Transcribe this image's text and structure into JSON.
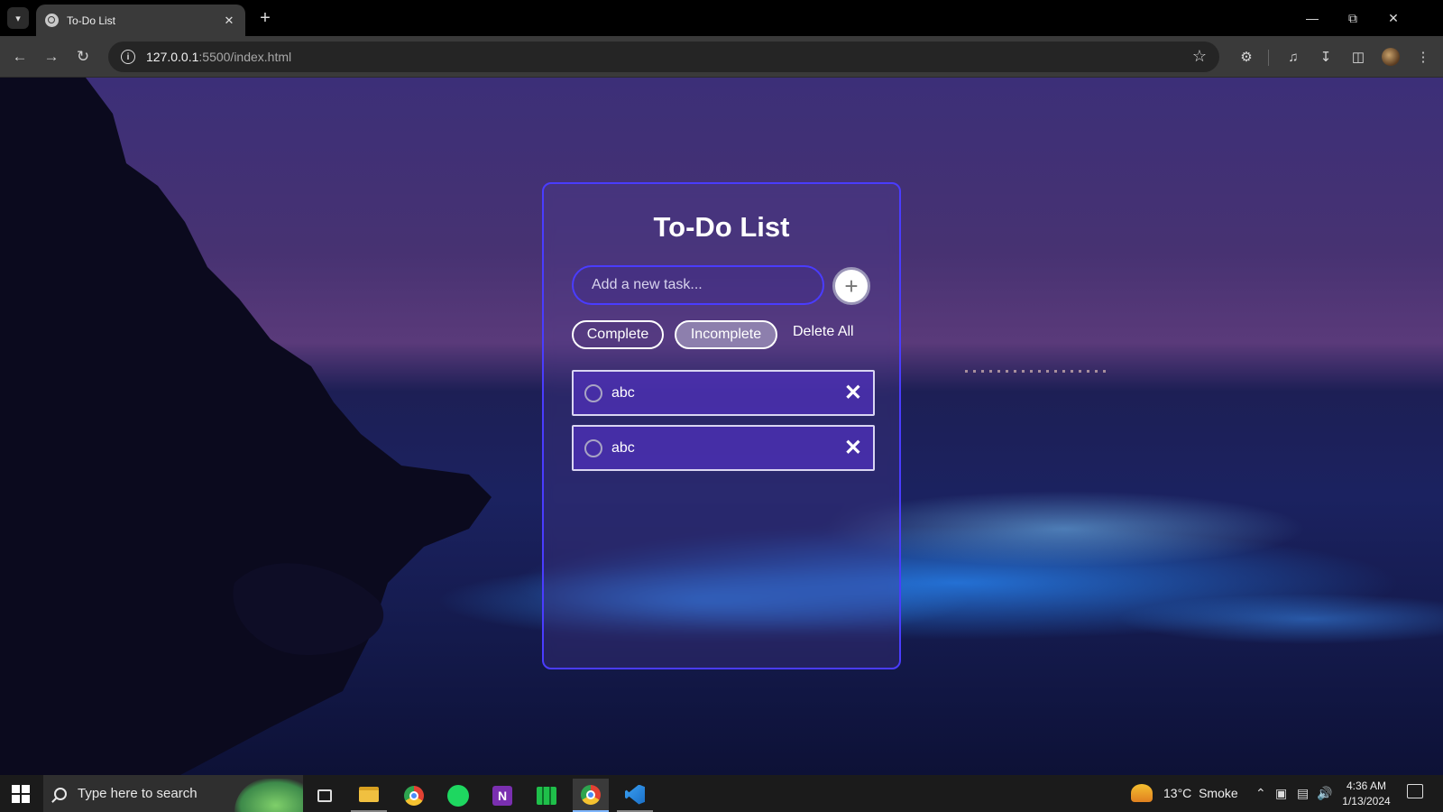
{
  "browser": {
    "tab_title": "To-Do List",
    "url_host": "127.0.0.1",
    "url_path": ":5500/index.html"
  },
  "app": {
    "title": "To-Do List",
    "input_placeholder": "Add a new task...",
    "add_button_label": "+",
    "filters": {
      "complete": "Complete",
      "incomplete": "Incomplete",
      "delete_all": "Delete All"
    },
    "tasks": [
      {
        "text": "abc",
        "completed": false
      },
      {
        "text": "abc",
        "completed": false
      }
    ],
    "accent_color": "#4a3cff"
  },
  "taskbar": {
    "search_placeholder": "Type here to search",
    "weather_temp": "13°C",
    "weather_condition": "Smoke",
    "time": "4:36 AM",
    "date": "1/13/2024"
  }
}
